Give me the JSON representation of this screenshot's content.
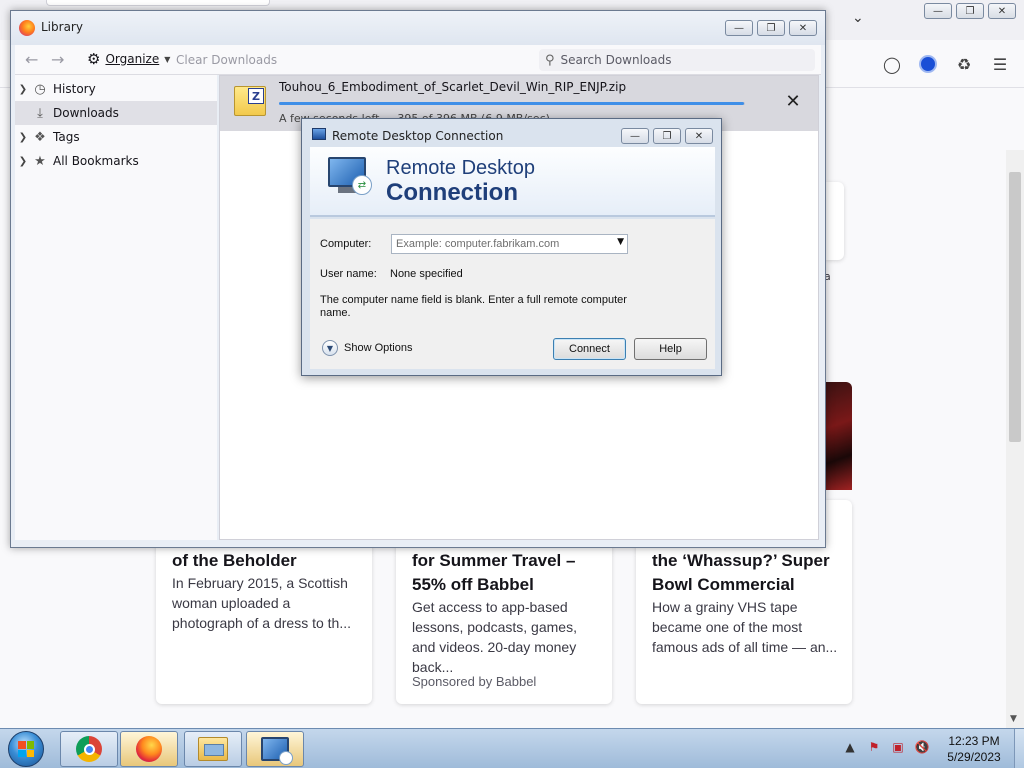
{
  "library": {
    "title": "Library",
    "toolbar": {
      "organize": "Organize",
      "clear_downloads": "Clear Downloads",
      "search_placeholder": "Search Downloads"
    },
    "sidebar": [
      {
        "label": "History",
        "icon": "clock-icon"
      },
      {
        "label": "Downloads",
        "icon": "download-arrow-icon",
        "selected": true
      },
      {
        "label": "Tags",
        "icon": "tag-icon"
      },
      {
        "label": "All Bookmarks",
        "icon": "star-icon"
      }
    ],
    "download": {
      "filename": "Touhou_6_Embodiment_of_Scarlet_Devil_Win_RIP_ENJP.zip",
      "status": "A few seconds left — 395 of 396 MB (6.9 MB/sec)",
      "progress": 0.997
    }
  },
  "rdp": {
    "title": "Remote Desktop Connection",
    "banner_line1": "Remote Desktop",
    "banner_line2": "Connection",
    "computer_label": "Computer:",
    "computer_placeholder": "Example: computer.fabrikam.com",
    "username_label": "User name:",
    "username_value": "None specified",
    "message": "The computer name field is blank.  Enter a full remote computer name.",
    "show_options": "Show Options",
    "connect": "Connect",
    "help": "Help"
  },
  "background_cards": [
    {
      "title": "of the Beholder",
      "body": "In February 2015, a Scottish woman uploaded a photograph of a dress to th..."
    },
    {
      "title": "for Summer Travel – 55% off Babbel",
      "body": "Get access to app-based lessons, podcasts, games, and videos. 20-day money back...",
      "sponsor": "Sponsored by Babbel"
    },
    {
      "title": "the ‘Whassup?’ Super Bowl Commercial",
      "body": "How a grainy VHS tape became one of the most famous ads of all time — an..."
    }
  ],
  "background_fragment": "a",
  "taskbar": {
    "apps": [
      "chrome-icon",
      "firefox-icon",
      "file-explorer-icon",
      "remote-desktop-icon"
    ],
    "time": "12:23 PM",
    "date": "5/29/2023"
  },
  "colors": {
    "progress": "#3f8fe8",
    "rdp_banner_text": "#1f3f7a"
  }
}
